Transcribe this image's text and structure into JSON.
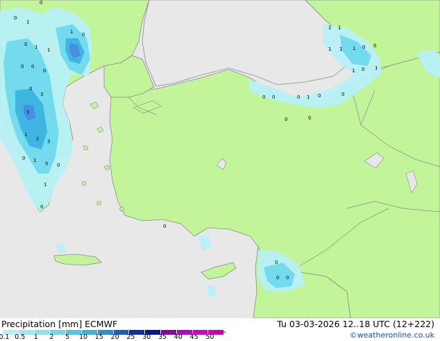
{
  "product": {
    "title": "Precipitation [mm]  ECMWF",
    "valid_time": "Tu 03-03-2026 12..18 UTC (12+222)",
    "credit": "©weatheronline.co.uk"
  },
  "colors": {
    "sea": "#e8e8e8",
    "land": "#c2f59a",
    "coast": "#8a8a8a",
    "precip_light": "#b7f0f7",
    "precip_mid": "#70d8ec",
    "precip_heavy": "#3cb4e0",
    "precip_peak": "#4a8be0"
  },
  "legend": {
    "ticks": [
      "0.1",
      "0.5",
      "1",
      "2",
      "5",
      "10",
      "15",
      "20",
      "25",
      "30",
      "35",
      "40",
      "45",
      "50"
    ],
    "swatch_colors": [
      "#b7f0f7",
      "#a3e9f3",
      "#8ce0ef",
      "#70d8ec",
      "#52c6e6",
      "#3cb4e0",
      "#2a8fd4",
      "#1a5ec0",
      "#0e2fa8",
      "#0a1490",
      "#8a00b0",
      "#b400c8",
      "#d000c8",
      "#e000b4"
    ]
  },
  "map": {
    "station_values": [
      {
        "text": "0"
      },
      {
        "text": "0"
      },
      {
        "text": "1"
      },
      {
        "text": "0"
      },
      {
        "text": "1"
      },
      {
        "text": "1"
      },
      {
        "text": "0"
      },
      {
        "text": "1"
      },
      {
        "text": "0"
      },
      {
        "text": "0"
      },
      {
        "text": "0"
      },
      {
        "text": "3"
      },
      {
        "text": "0"
      },
      {
        "text": "3"
      },
      {
        "text": "1"
      },
      {
        "text": "2"
      },
      {
        "text": "3"
      },
      {
        "text": "0"
      },
      {
        "text": "1"
      },
      {
        "text": "5"
      },
      {
        "text": "0"
      },
      {
        "text": "1"
      },
      {
        "text": "0"
      },
      {
        "text": "1"
      },
      {
        "text": "1"
      },
      {
        "text": "1"
      },
      {
        "text": "1"
      },
      {
        "text": "1"
      },
      {
        "text": "0"
      },
      {
        "text": "0"
      },
      {
        "text": "1"
      },
      {
        "text": "0"
      },
      {
        "text": "1"
      },
      {
        "text": "0"
      },
      {
        "text": "0"
      },
      {
        "text": "0"
      },
      {
        "text": "1"
      },
      {
        "text": "0"
      },
      {
        "text": "0"
      },
      {
        "text": "0"
      },
      {
        "text": "0"
      },
      {
        "text": "0"
      },
      {
        "text": "0"
      },
      {
        "text": "0"
      },
      {
        "text": "0"
      }
    ]
  }
}
